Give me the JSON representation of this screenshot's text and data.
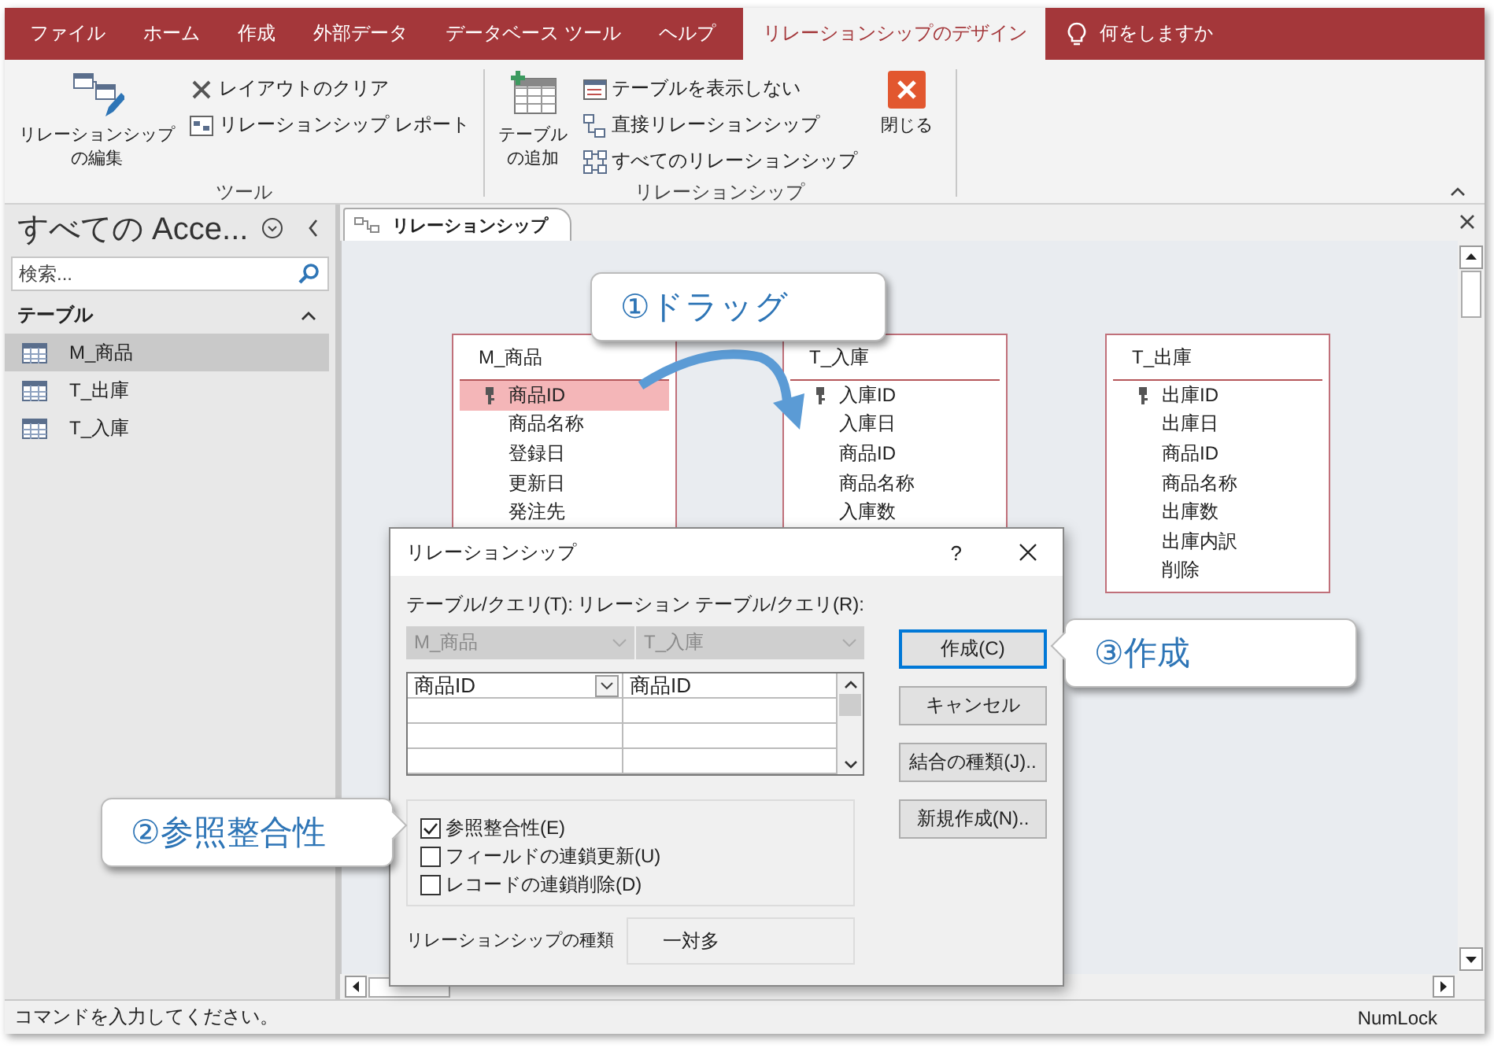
{
  "ribbon_tabs": [
    {
      "label": "ファイル",
      "selected": false
    },
    {
      "label": "ホーム",
      "selected": false
    },
    {
      "label": "作成",
      "selected": false
    },
    {
      "label": "外部データ",
      "selected": false
    },
    {
      "label": "データベース ツール",
      "selected": false
    },
    {
      "label": "ヘルプ",
      "selected": false
    },
    {
      "label": "リレーションシップのデザイン",
      "selected": true
    }
  ],
  "tell_me": "何をしますか",
  "ribbon_groups": [
    {
      "label": "ツール",
      "buttons": [
        {
          "kind": "large",
          "label": "リレーションシップの編集"
        },
        {
          "kind": "stack",
          "items": [
            "レイアウトのクリア",
            "リレーションシップ レポート"
          ]
        }
      ]
    },
    {
      "label": "リレーションシップ",
      "buttons": [
        {
          "kind": "large",
          "label": "テーブルの追加"
        },
        {
          "kind": "stack",
          "items": [
            "テーブルを表示しない",
            "直接リレーションシップ",
            "すべてのリレーションシップ"
          ]
        },
        {
          "kind": "large",
          "label": "閉じる"
        }
      ]
    }
  ],
  "nav": {
    "title": "すべての Acce...",
    "search": {
      "placeholder": "検索..."
    },
    "section": {
      "label": "テーブル",
      "expanded": true
    },
    "items": [
      {
        "label": "M_商品",
        "selected": true
      },
      {
        "label": "T_出庫",
        "selected": false
      },
      {
        "label": "T_入庫",
        "selected": false
      }
    ]
  },
  "document": {
    "tab": "リレーションシップ",
    "tables": [
      {
        "name": "M_商品",
        "fields": [
          {
            "name": "商品ID",
            "key": true,
            "selected": true
          },
          {
            "name": "商品名称",
            "key": false,
            "selected": false
          },
          {
            "name": "登録日",
            "key": false,
            "selected": false
          },
          {
            "name": "更新日",
            "key": false,
            "selected": false
          },
          {
            "name": "発注先",
            "key": false,
            "selected": false
          }
        ]
      },
      {
        "name": "T_入庫",
        "fields": [
          {
            "name": "入庫ID",
            "key": true,
            "selected": false
          },
          {
            "name": "入庫日",
            "key": false,
            "selected": false
          },
          {
            "name": "商品ID",
            "key": false,
            "selected": false
          },
          {
            "name": "商品名称",
            "key": false,
            "selected": false
          },
          {
            "name": "入庫数",
            "key": false,
            "selected": false
          }
        ]
      },
      {
        "name": "T_出庫",
        "fields": [
          {
            "name": "出庫ID",
            "key": true,
            "selected": false
          },
          {
            "name": "出庫日",
            "key": false,
            "selected": false
          },
          {
            "name": "商品ID",
            "key": false,
            "selected": false
          },
          {
            "name": "商品名称",
            "key": false,
            "selected": false
          },
          {
            "name": "出庫数",
            "key": false,
            "selected": false
          },
          {
            "name": "出庫内訳",
            "key": false,
            "selected": false
          },
          {
            "name": "削除",
            "key": false,
            "selected": false
          }
        ]
      }
    ]
  },
  "dialog": {
    "title": "リレーションシップ",
    "help": "?",
    "left_label": "テーブル/クエリ(T):",
    "right_label": "リレーション テーブル/クエリ(R):",
    "left_table": {
      "value": "M_商品",
      "disabled": true
    },
    "right_table": {
      "value": "T_入庫",
      "disabled": true
    },
    "field_rows": [
      {
        "left": "商品ID",
        "right": "商品ID"
      }
    ],
    "options": [
      {
        "label": "参照整合性(E)",
        "checked": true
      },
      {
        "label": "フィールドの連鎖更新(U)",
        "checked": false
      },
      {
        "label": "レコードの連鎖削除(D)",
        "checked": false
      }
    ],
    "type_label": "リレーションシップの種類",
    "type_value": "一対多",
    "buttons": [
      {
        "label": "作成(C)",
        "default": true
      },
      {
        "label": "キャンセル",
        "default": false
      },
      {
        "label": "結合の種類(J)..",
        "default": false
      },
      {
        "label": "新規作成(N)..",
        "default": false
      }
    ]
  },
  "callouts": [
    {
      "text": "①ドラッグ"
    },
    {
      "text": "②参照整合性"
    },
    {
      "text": "③作成"
    }
  ],
  "status_bar": {
    "message": "コマンドを入力してください。",
    "indicator": "NumLock"
  }
}
